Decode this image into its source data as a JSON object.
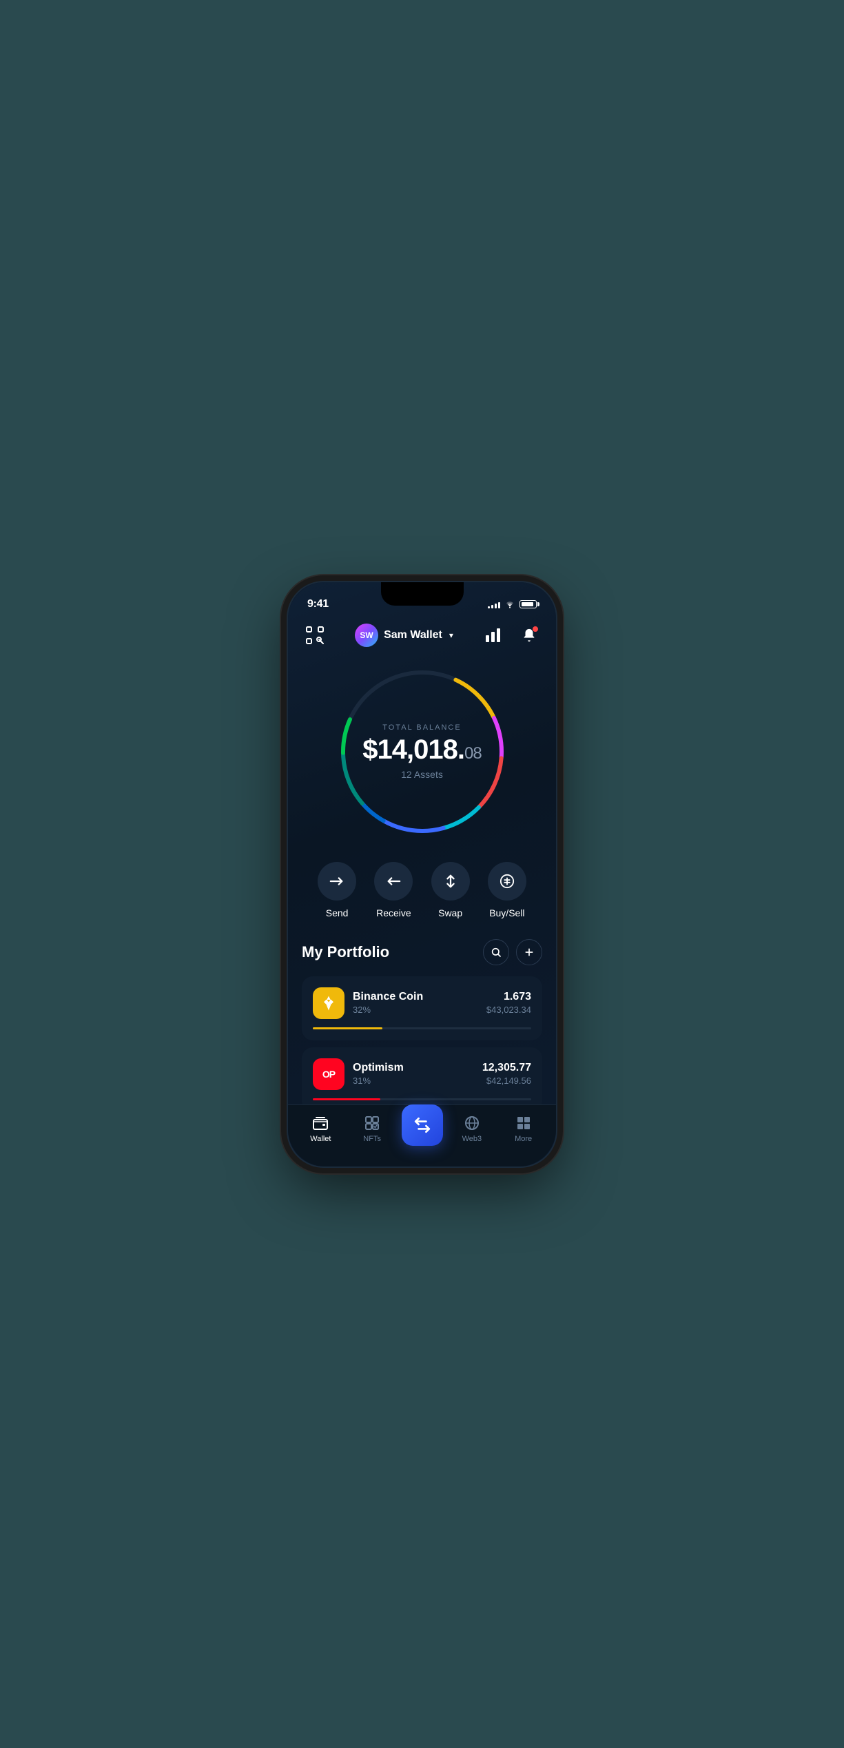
{
  "status": {
    "time": "9:41",
    "signal_bars": [
      3,
      5,
      7,
      9,
      11
    ],
    "battery_level": "90%"
  },
  "header": {
    "scan_label": "scan",
    "profile_initials": "SW",
    "profile_name": "Sam Wallet",
    "chevron": "▾",
    "chart_label": "chart",
    "bell_label": "bell"
  },
  "balance": {
    "label": "TOTAL BALANCE",
    "amount_main": "$14,018.",
    "amount_cents": "08",
    "assets_count": "12 Assets"
  },
  "actions": [
    {
      "id": "send",
      "label": "Send",
      "icon": "→"
    },
    {
      "id": "receive",
      "label": "Receive",
      "icon": "←"
    },
    {
      "id": "swap",
      "label": "Swap",
      "icon": "⇅"
    },
    {
      "id": "buysell",
      "label": "Buy/Sell",
      "icon": "◎"
    }
  ],
  "portfolio": {
    "title": "My Portfolio",
    "search_label": "search",
    "add_label": "add",
    "assets": [
      {
        "id": "bnb",
        "name": "Binance Coin",
        "pct": "32%",
        "amount": "1.673",
        "usd": "$43,023.34",
        "bar_color": "#F0B90B",
        "bar_width": "32%",
        "icon_bg": "#F0B90B",
        "icon_text": "⬡"
      },
      {
        "id": "op",
        "name": "Optimism",
        "pct": "31%",
        "amount": "12,305.77",
        "usd": "$42,149.56",
        "bar_color": "#ff0420",
        "bar_width": "31%",
        "icon_bg": "#ff0420",
        "icon_text": "OP"
      }
    ]
  },
  "bottom_nav": {
    "items": [
      {
        "id": "wallet",
        "label": "Wallet",
        "active": true,
        "icon": "wallet"
      },
      {
        "id": "nfts",
        "label": "NFTs",
        "active": false,
        "icon": "nfts"
      },
      {
        "id": "center",
        "label": "",
        "active": false,
        "icon": "swap-center"
      },
      {
        "id": "web3",
        "label": "Web3",
        "active": false,
        "icon": "web3"
      },
      {
        "id": "more",
        "label": "More",
        "active": false,
        "icon": "more"
      }
    ]
  },
  "colors": {
    "accent_blue": "#3b6aff",
    "bg_dark": "#0d1b2e",
    "bg_card": "#0f1d2e",
    "text_muted": "#6b8099"
  }
}
